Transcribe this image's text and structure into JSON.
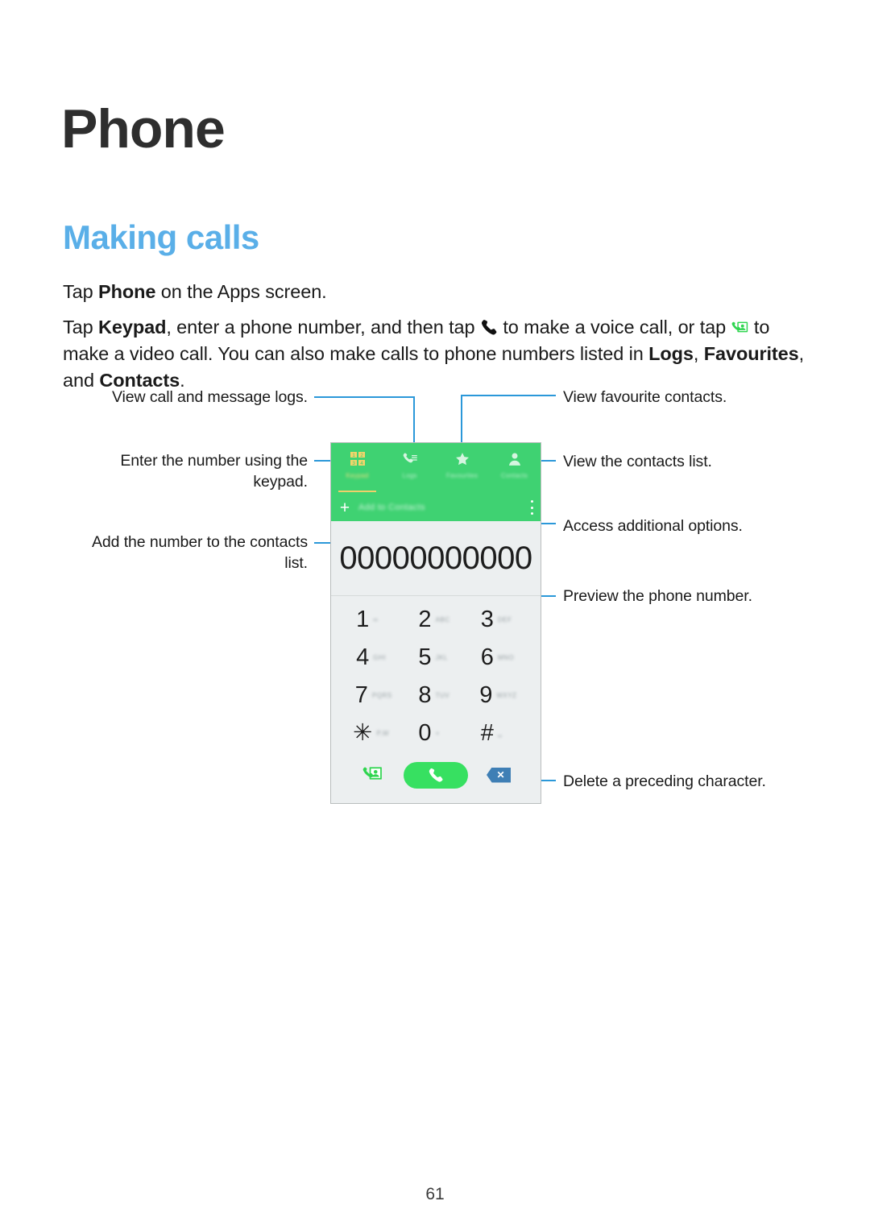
{
  "page": {
    "title": "Phone",
    "section_title": "Making calls",
    "number": "61"
  },
  "paragraphs": {
    "p1_a": "Tap ",
    "p1_b": "Phone",
    "p1_c": " on the Apps screen.",
    "p2_a": "Tap ",
    "p2_b": "Keypad",
    "p2_c": ", enter a phone number, and then tap ",
    "p2_d": " to make a voice call, or tap ",
    "p2_e": " to make a video call. You can also make calls to phone numbers listed in ",
    "p2_f": "Logs",
    "p2_g": ", ",
    "p2_h": "Favourites",
    "p2_i": ", and ",
    "p2_j": "Contacts",
    "p2_k": "."
  },
  "callouts": {
    "logs": "View call and message logs.",
    "keypad": "Enter the number using the\nkeypad.",
    "keypad_l1": "Enter the number using the",
    "keypad_l2": "keypad.",
    "add_contacts_l1": "Add the number to the contacts",
    "add_contacts_l2": "list.",
    "favourites": "View favourite contacts.",
    "contacts": "View the contacts list.",
    "options": "Access additional options.",
    "preview": "Preview the phone number.",
    "delete": "Delete a preceding character."
  },
  "phone": {
    "tabs": [
      {
        "label": "Keypad",
        "icon": "keypad-grid-icon",
        "active": true
      },
      {
        "label": "Logs",
        "icon": "call-log-icon",
        "active": false
      },
      {
        "label": "Favourites",
        "icon": "star-icon",
        "active": false
      },
      {
        "label": "Contacts",
        "icon": "person-icon",
        "active": false
      }
    ],
    "action_row": {
      "plus": "+",
      "label": "Add to Contacts",
      "overflow": "more-options-icon"
    },
    "number_value": "00000000000",
    "keypad": [
      [
        {
          "digit": "1",
          "sub": "∞"
        },
        {
          "digit": "2",
          "sub": "ABC"
        },
        {
          "digit": "3",
          "sub": "DEF"
        }
      ],
      [
        {
          "digit": "4",
          "sub": "GHI"
        },
        {
          "digit": "5",
          "sub": "JKL"
        },
        {
          "digit": "6",
          "sub": "MNO"
        }
      ],
      [
        {
          "digit": "7",
          "sub": "PQRS"
        },
        {
          "digit": "8",
          "sub": "TUV"
        },
        {
          "digit": "9",
          "sub": "WXYZ"
        }
      ],
      [
        {
          "digit": "✳",
          "sub": "P,W"
        },
        {
          "digit": "0",
          "sub": "+"
        },
        {
          "digit": "#",
          "sub": "␣"
        }
      ]
    ],
    "bottom": {
      "video_call": "video-call-icon",
      "call": "call-icon",
      "backspace": "backspace-icon"
    }
  },
  "colors": {
    "accent_blue": "#5aafe8",
    "leader_blue": "#2b98d9",
    "header_green": "#3fd272",
    "call_green": "#37e061",
    "tab_underline": "#f0cf6a",
    "backspace_blue": "#3f7fb5"
  }
}
